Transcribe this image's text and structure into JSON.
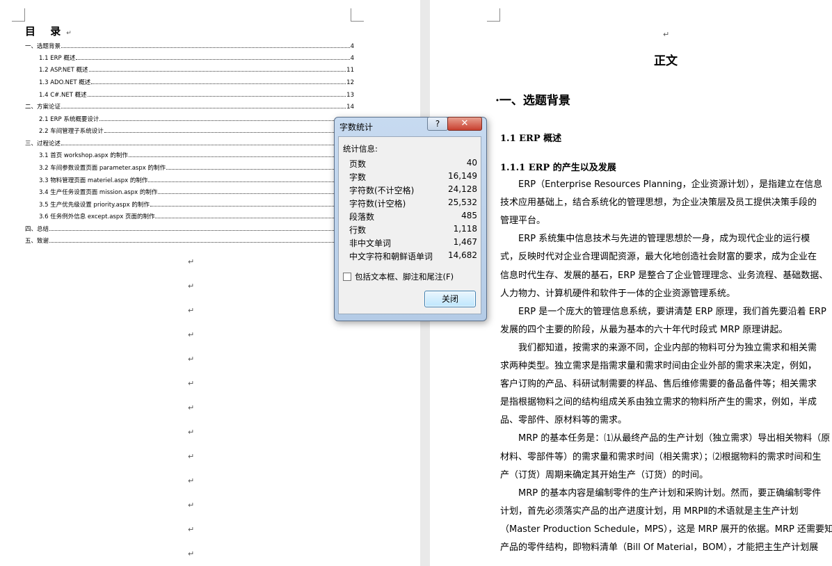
{
  "toc": {
    "title": "目 录",
    "entries": [
      {
        "text": "一、选题背景",
        "page": "4"
      },
      {
        "text": "1.1 ERP 概述",
        "page": "4"
      },
      {
        "text": "1.2 ASP.NET 概述",
        "page": "11"
      },
      {
        "text": "1.3 ADO.NET 概述",
        "page": "12"
      },
      {
        "text": "1.4 C#.NET 概述",
        "page": "13"
      },
      {
        "text": "二、方案论证",
        "page": "14"
      },
      {
        "text": "2.1 ERP 系统概要设计",
        "page": ""
      },
      {
        "text": "2.2 车间管理子系统设计",
        "page": ""
      },
      {
        "text": "三、过程论述",
        "page": ""
      },
      {
        "text": "3.1 首页 workshop.aspx 的制作",
        "page": ""
      },
      {
        "text": "3.2 车间参数设置页面 parameter.aspx 的制作",
        "page": ""
      },
      {
        "text": "3.3 物料管理页面 materiel.aspx 的制作",
        "page": ""
      },
      {
        "text": "3.4 生产任务设置页面 mission.aspx 的制作",
        "page": ""
      },
      {
        "text": "3.5 生产优先级设置 priority.aspx 的制作",
        "page": ""
      },
      {
        "text": "3.6 任务例外信息 except.aspx 页面的制作",
        "page": ""
      },
      {
        "text": "四、总结",
        "page": ""
      },
      {
        "text": "五、致谢",
        "page": ""
      }
    ]
  },
  "paragraph_mark": "↵",
  "doc": {
    "main_heading": "正文",
    "h1": "一、选题背景",
    "h2": "1.1 ERP 概述",
    "h3": "1.1.1 ERP 的产生以及发展",
    "lines": [
      "　　ERP（Enterprise Resources Planning，企业资源计划），是指建立在信息",
      "技术应用基础上，结合系统化的管理思想，为企业决策层及员工提供决策手段的",
      "管理平台。",
      "　　ERP 系统集中信息技术与先进的管理思想於一身，成为现代企业的运行模",
      "式，反映时代对企业合理调配资源，最大化地创造社会财富的要求，成为企业在",
      "信息时代生存、发展的基石，ERP 是整合了企业管理理念、业务流程、基础数据、",
      "人力物力、计算机硬件和软件于一体的企业资源管理系统。",
      "　　ERP 是一个庞大的管理信息系统，要讲清楚 ERP 原理，我们首先要沿着 ERP",
      "发展的四个主要的阶段，从最为基本的六十年代时段式 MRP 原理讲起。",
      "　　我们都知道，按需求的来源不同，企业内部的物料可分为独立需求和相关需",
      "求两种类型。独立需求是指需求量和需求时间由企业外部的需求来决定，例如，",
      "客户订购的产品、科研试制需要的样品、售后维修需要的备品备件等；相关需求",
      "是指根据物料之间的结构组成关系由独立需求的物料所产生的需求，例如，半成",
      "品、零部件、原材料等的需求。",
      "　　MRP 的基本任务是：⑴从最终产品的生产计划（独立需求）导出相关物料（原",
      "材料、零部件等）的需求量和需求时间（相关需求）；⑵根据物料的需求时间和生",
      "产（订货）周期来确定其开始生产（订货）的时间。",
      "　　MRP 的基本内容是编制零件的生产计划和采购计划。然而，要正确编制零件",
      "计划，首先必须落实产品的出产进度计划，用 MRPⅡ的术语就是主生产计划",
      "（Master Production Schedule，MPS），这是 MRP 展开的依据。MRP 还需要知道",
      "产品的零件结构，即物料清单（Bill Of Material，BOM），才能把主生产计划展"
    ]
  },
  "dialog": {
    "title": "字数统计",
    "help": "?",
    "close_x": "✕",
    "section": "统计信息:",
    "stats": [
      {
        "label": "页数",
        "value": "40"
      },
      {
        "label": "字数",
        "value": "16,149"
      },
      {
        "label": "字符数(不计空格)",
        "value": "24,128"
      },
      {
        "label": "字符数(计空格)",
        "value": "25,532"
      },
      {
        "label": "段落数",
        "value": "485"
      },
      {
        "label": "行数",
        "value": "1,118"
      },
      {
        "label": "非中文单词",
        "value": "1,467"
      },
      {
        "label": "中文字符和朝鲜语单词",
        "value": "14,682"
      }
    ],
    "checkbox_label": "包括文本框、脚注和尾注(F)",
    "close_button": "关闭"
  }
}
